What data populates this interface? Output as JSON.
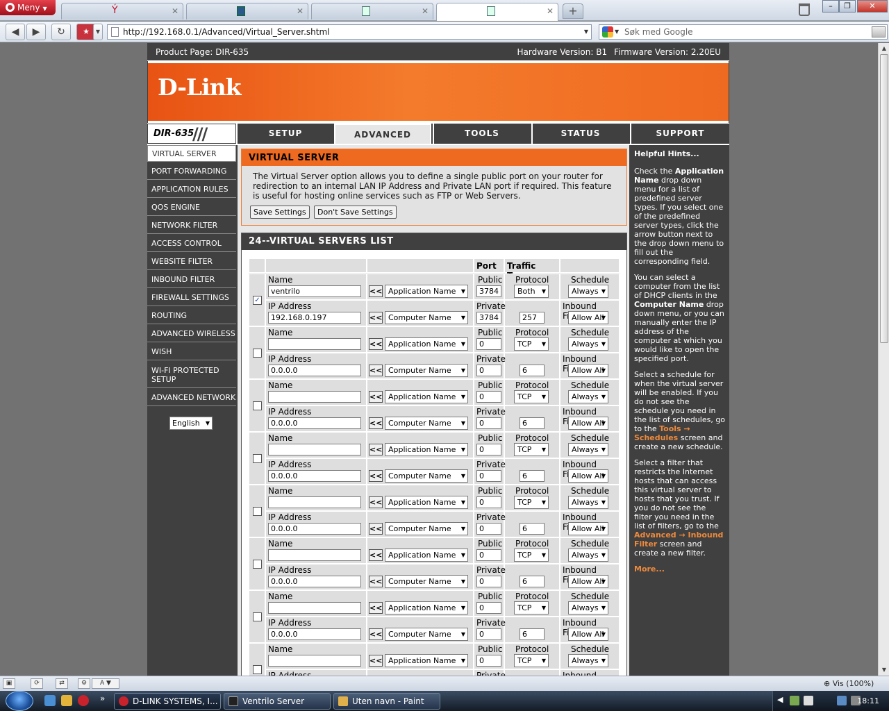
{
  "browser": {
    "menu_label": "Meny",
    "active_tab_close": "✕",
    "url": "http://192.168.0.1/Advanced/Virtual_Server.shtml",
    "search_placeholder": "Søk med Google",
    "zoom": "Vis (100%)"
  },
  "router": {
    "product_page": "Product Page: DIR-635",
    "hardware_version": "Hardware Version: B1",
    "firmware_version": "Firmware Version: 2.20EU",
    "logo": "D-Link",
    "model": "DIR-635",
    "tabs": [
      "SETUP",
      "ADVANCED",
      "TOOLS",
      "STATUS",
      "SUPPORT"
    ],
    "active_tab": "ADVANCED",
    "left_nav": [
      "VIRTUAL SERVER",
      "PORT FORWARDING",
      "APPLICATION RULES",
      "QOS ENGINE",
      "NETWORK FILTER",
      "ACCESS CONTROL",
      "WEBSITE FILTER",
      "INBOUND FILTER",
      "FIREWALL SETTINGS",
      "ROUTING",
      "ADVANCED WIRELESS",
      "WISH",
      "WI-FI PROTECTED SETUP",
      "ADVANCED NETWORK"
    ],
    "language": "English"
  },
  "virtual_server": {
    "title": "VIRTUAL SERVER",
    "description": "The Virtual Server option allows you to define a single public port on your router for redirection to an internal LAN IP Address and Private LAN port if required. This feature is useful for hosting online services such as FTP or Web Servers.",
    "save_label": "Save Settings",
    "dont_save_label": "Don't Save Settings"
  },
  "list": {
    "title": "24--VIRTUAL SERVERS LIST",
    "header_port": "Port",
    "header_traffic": "Traffic Type",
    "label_name": "Name",
    "label_ip": "IP Address",
    "label_public": "Public",
    "label_private": "Private",
    "label_protocol": "Protocol",
    "label_schedule": "Schedule",
    "label_inbound": "Inbound Filter",
    "arrow_label": "<<",
    "app_name_select": "Application Name",
    "computer_name_select": "Computer Name",
    "rows": [
      {
        "checked": true,
        "name": "ventrilo",
        "ip": "192.168.0.197",
        "public": "3784",
        "private": "3784",
        "protocol": "Both",
        "proto_num": "257",
        "schedule": "Always",
        "inbound": "Allow All"
      },
      {
        "checked": false,
        "name": "",
        "ip": "0.0.0.0",
        "public": "0",
        "private": "0",
        "protocol": "TCP",
        "proto_num": "6",
        "schedule": "Always",
        "inbound": "Allow All"
      },
      {
        "checked": false,
        "name": "",
        "ip": "0.0.0.0",
        "public": "0",
        "private": "0",
        "protocol": "TCP",
        "proto_num": "6",
        "schedule": "Always",
        "inbound": "Allow All"
      },
      {
        "checked": false,
        "name": "",
        "ip": "0.0.0.0",
        "public": "0",
        "private": "0",
        "protocol": "TCP",
        "proto_num": "6",
        "schedule": "Always",
        "inbound": "Allow All"
      },
      {
        "checked": false,
        "name": "",
        "ip": "0.0.0.0",
        "public": "0",
        "private": "0",
        "protocol": "TCP",
        "proto_num": "6",
        "schedule": "Always",
        "inbound": "Allow All"
      },
      {
        "checked": false,
        "name": "",
        "ip": "0.0.0.0",
        "public": "0",
        "private": "0",
        "protocol": "TCP",
        "proto_num": "6",
        "schedule": "Always",
        "inbound": "Allow All"
      },
      {
        "checked": false,
        "name": "",
        "ip": "0.0.0.0",
        "public": "0",
        "private": "0",
        "protocol": "TCP",
        "proto_num": "6",
        "schedule": "Always",
        "inbound": "Allow All"
      },
      {
        "checked": false,
        "name": "",
        "ip": "",
        "public": "0",
        "private": "",
        "protocol": "TCP",
        "proto_num": "",
        "schedule": "Always",
        "inbound": "Inbound Filter"
      }
    ]
  },
  "hints": {
    "title": "Helpful Hints...",
    "p1a": "Check the ",
    "p1b": "Application Name",
    "p1c": " drop down menu for a list of predefined server types. If you select one of the predefined server types, click the arrow button next to the drop down menu to fill out the corresponding field.",
    "p2a": "You can select a computer from the list of DHCP clients in the ",
    "p2b": "Computer Name",
    "p2c": " drop down menu, or you can manually enter the IP address of the computer at which you would like to open the specified port.",
    "p3a": "Select a schedule for when the virtual server will be enabled. If you do not see the schedule you need in the list of schedules, go to the ",
    "p3b": "Tools → Schedules",
    "p3c": " screen and create a new schedule.",
    "p4a": "Select a filter that restricts the Internet hosts that can access this virtual server to hosts that you trust. If you do not see the filter you need in the list of filters, go to the ",
    "p4b": "Advanced → Inbound Filter",
    "p4c": " screen and create a new filter.",
    "more": "More..."
  },
  "taskbar": {
    "items": [
      "D-LINK SYSTEMS, I...",
      "Ventrilo Server",
      "Uten navn - Paint"
    ],
    "clock": "18:11"
  }
}
